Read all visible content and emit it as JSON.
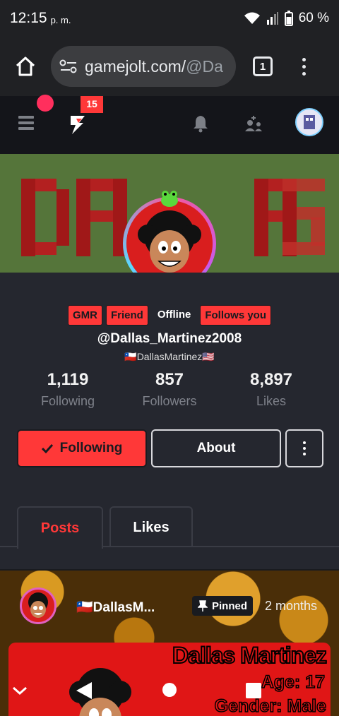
{
  "status": {
    "time": "12:15",
    "ampm": "p. m.",
    "battery": "60 %"
  },
  "browser": {
    "url_domain": "gamejolt.com/",
    "url_path": "@Da",
    "tab_count": "1"
  },
  "site": {
    "notif_badge": "15"
  },
  "profile": {
    "tags": [
      "GMR",
      "Friend",
      "Offline",
      "Follows you"
    ],
    "username": "@Dallas_Martinez2008",
    "display_name": "🇨🇱DallasMartinez🇺🇸",
    "stats": [
      {
        "value": "1,119",
        "label": "Following"
      },
      {
        "value": "857",
        "label": "Followers"
      },
      {
        "value": "8,897",
        "label": "Likes"
      }
    ],
    "following_label": "Following",
    "about_label": "About"
  },
  "banner": {
    "text": "DALLAS"
  },
  "tabs": {
    "posts": "Posts",
    "likes": "Likes"
  },
  "post": {
    "author": "🇨🇱DallasM...",
    "pinned": "Pinned",
    "time": "2 months",
    "card_title": "Dallas Martinez",
    "card_age": "Age: 17",
    "card_gender": "Gender: Male"
  }
}
